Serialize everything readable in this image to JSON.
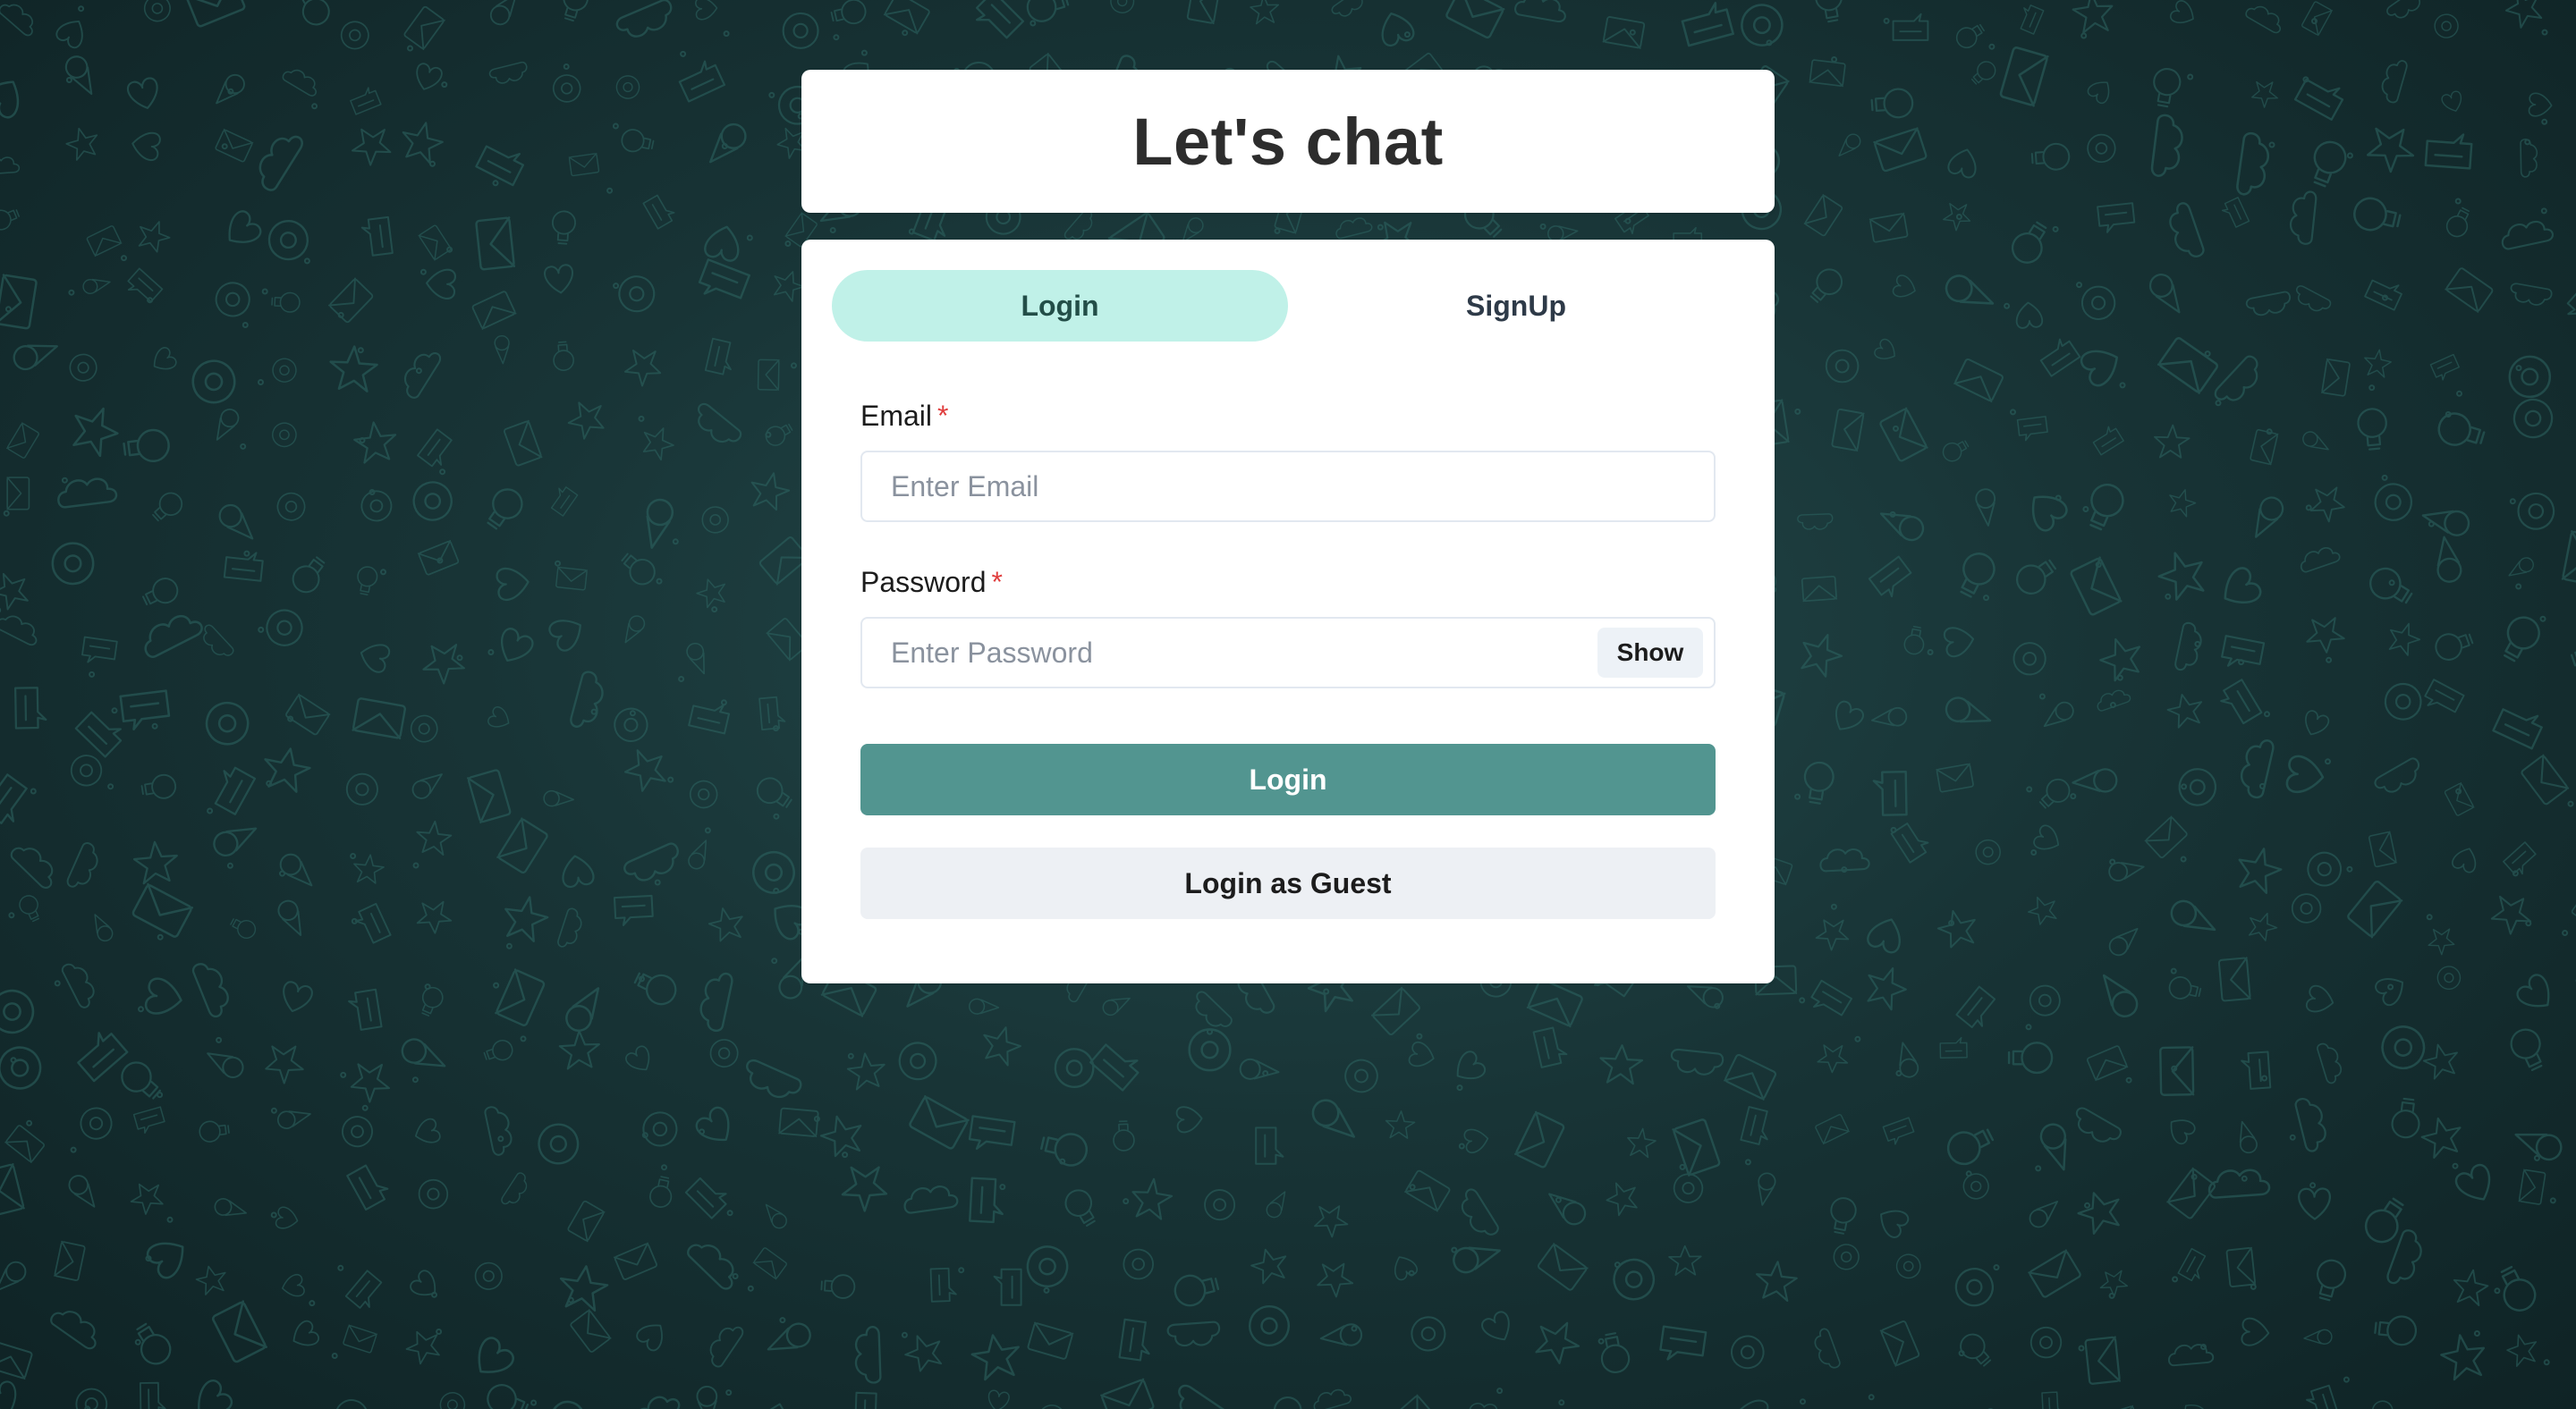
{
  "header": {
    "title": "Let's chat"
  },
  "tabs": [
    {
      "label": "Login",
      "active": true
    },
    {
      "label": "SignUp",
      "active": false
    }
  ],
  "form": {
    "email": {
      "label": "Email",
      "required_mark": "*",
      "value": "",
      "placeholder": "Enter Email"
    },
    "password": {
      "label": "Password",
      "required_mark": "*",
      "value": "",
      "placeholder": "Enter Password",
      "toggle_label": "Show"
    },
    "login_button": "Login",
    "guest_button": "Login as Guest"
  },
  "colors": {
    "background": "#183436",
    "doodle_stroke": "#2f6663",
    "active_tab": "#c0f1e8",
    "login_button": "#529590",
    "guest_button": "#edf0f4",
    "required": "#e03e3e"
  },
  "background_icons": [
    "envelope-icon",
    "star-icon",
    "heart-icon",
    "cloud-icon",
    "circle-icon",
    "bulb-icon",
    "ice-cream-icon",
    "chat-bubble-icon"
  ]
}
